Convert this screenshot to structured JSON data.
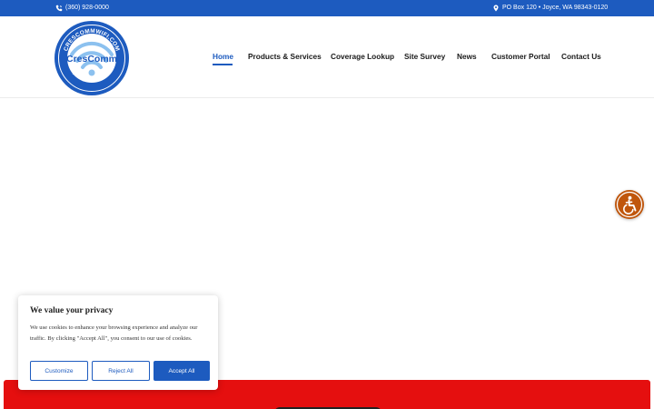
{
  "topbar": {
    "phone": "(360) 928-0000",
    "address": "PO Box 120 • Joyce, WA 98343-0120",
    "phone_icon": "phone-icon",
    "address_icon": "map-pin-icon"
  },
  "logo": {
    "brand": "CresComm",
    "ring_top": "CRESCOMMWIFI.COM",
    "ring_bottom": "(360) 928-0000"
  },
  "nav": {
    "items": [
      {
        "label": "Home",
        "active": true
      },
      {
        "label": "Products & Services",
        "active": false
      },
      {
        "label": "Coverage Lookup",
        "active": false
      },
      {
        "label": "Site Survey",
        "active": false
      },
      {
        "label": "News",
        "active": false
      },
      {
        "label": "Customer Portal",
        "active": false
      },
      {
        "label": "Contact Us",
        "active": false
      }
    ]
  },
  "cookie": {
    "title": "We value your privacy",
    "body": "We use cookies to enhance your browsing experience and analyze our traffic. By clicking \"Accept All\", you consent to our use of cookies.",
    "customize_label": "Customize",
    "reject_label": "Reject All",
    "accept_label": "Accept All"
  },
  "colors": {
    "brand_blue": "#1d5bbf",
    "accessibility_orange": "#c0560c",
    "footer_red": "#e50f0f"
  },
  "accessibility": {
    "icon": "accessibility-icon"
  }
}
